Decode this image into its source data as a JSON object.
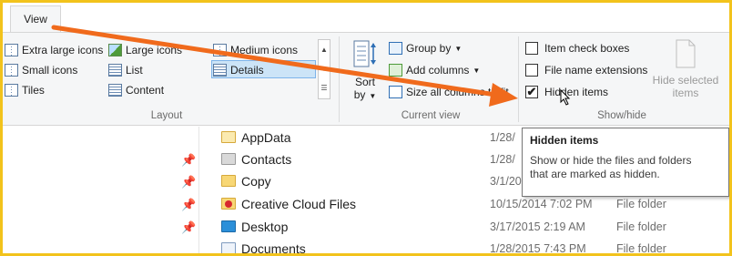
{
  "tabs": {
    "view": "View"
  },
  "layout_group": {
    "label": "Layout",
    "items": {
      "extra_large": "Extra large icons",
      "large": "Large icons",
      "medium": "Medium icons",
      "small": "Small icons",
      "list": "List",
      "details": "Details",
      "tiles": "Tiles",
      "content": "Content"
    }
  },
  "current_view_group": {
    "label": "Current view",
    "sort_by_line1": "Sort",
    "sort_by_line2": "by",
    "group_by": "Group by",
    "add_columns": "Add columns",
    "size_all_columns": "Size all columns to fit"
  },
  "show_hide_group": {
    "label": "Show/hide",
    "item_check_boxes": {
      "label": "Item check boxes",
      "checked": false
    },
    "file_name_extensions": {
      "label": "File name extensions",
      "checked": false
    },
    "hidden_items": {
      "label": "Hidden items",
      "checked": true,
      "check_glyph": "✔"
    },
    "hide_selected_line1": "Hide selected",
    "hide_selected_line2": "items"
  },
  "tooltip": {
    "title": "Hidden items",
    "description": "Show or hide the files and folders that are marked as hidden."
  },
  "files": [
    {
      "name": "AppData",
      "date": "1/28/",
      "type": ""
    },
    {
      "name": "Contacts",
      "date": "1/28/",
      "type": ""
    },
    {
      "name": "Copy",
      "date": "3/1/20",
      "type": ""
    },
    {
      "name": "Creative Cloud Files",
      "date": "10/15/2014 7:02 PM",
      "type": "File folder"
    },
    {
      "name": "Desktop",
      "date": "3/17/2015 2:19 AM",
      "type": "File folder"
    },
    {
      "name": "Documents",
      "date": "1/28/2015 7:43 PM",
      "type": "File folder"
    }
  ],
  "colors": {
    "arrow": "#f06a1c",
    "frame": "#f2c31c",
    "selected": "#cce4f7"
  }
}
